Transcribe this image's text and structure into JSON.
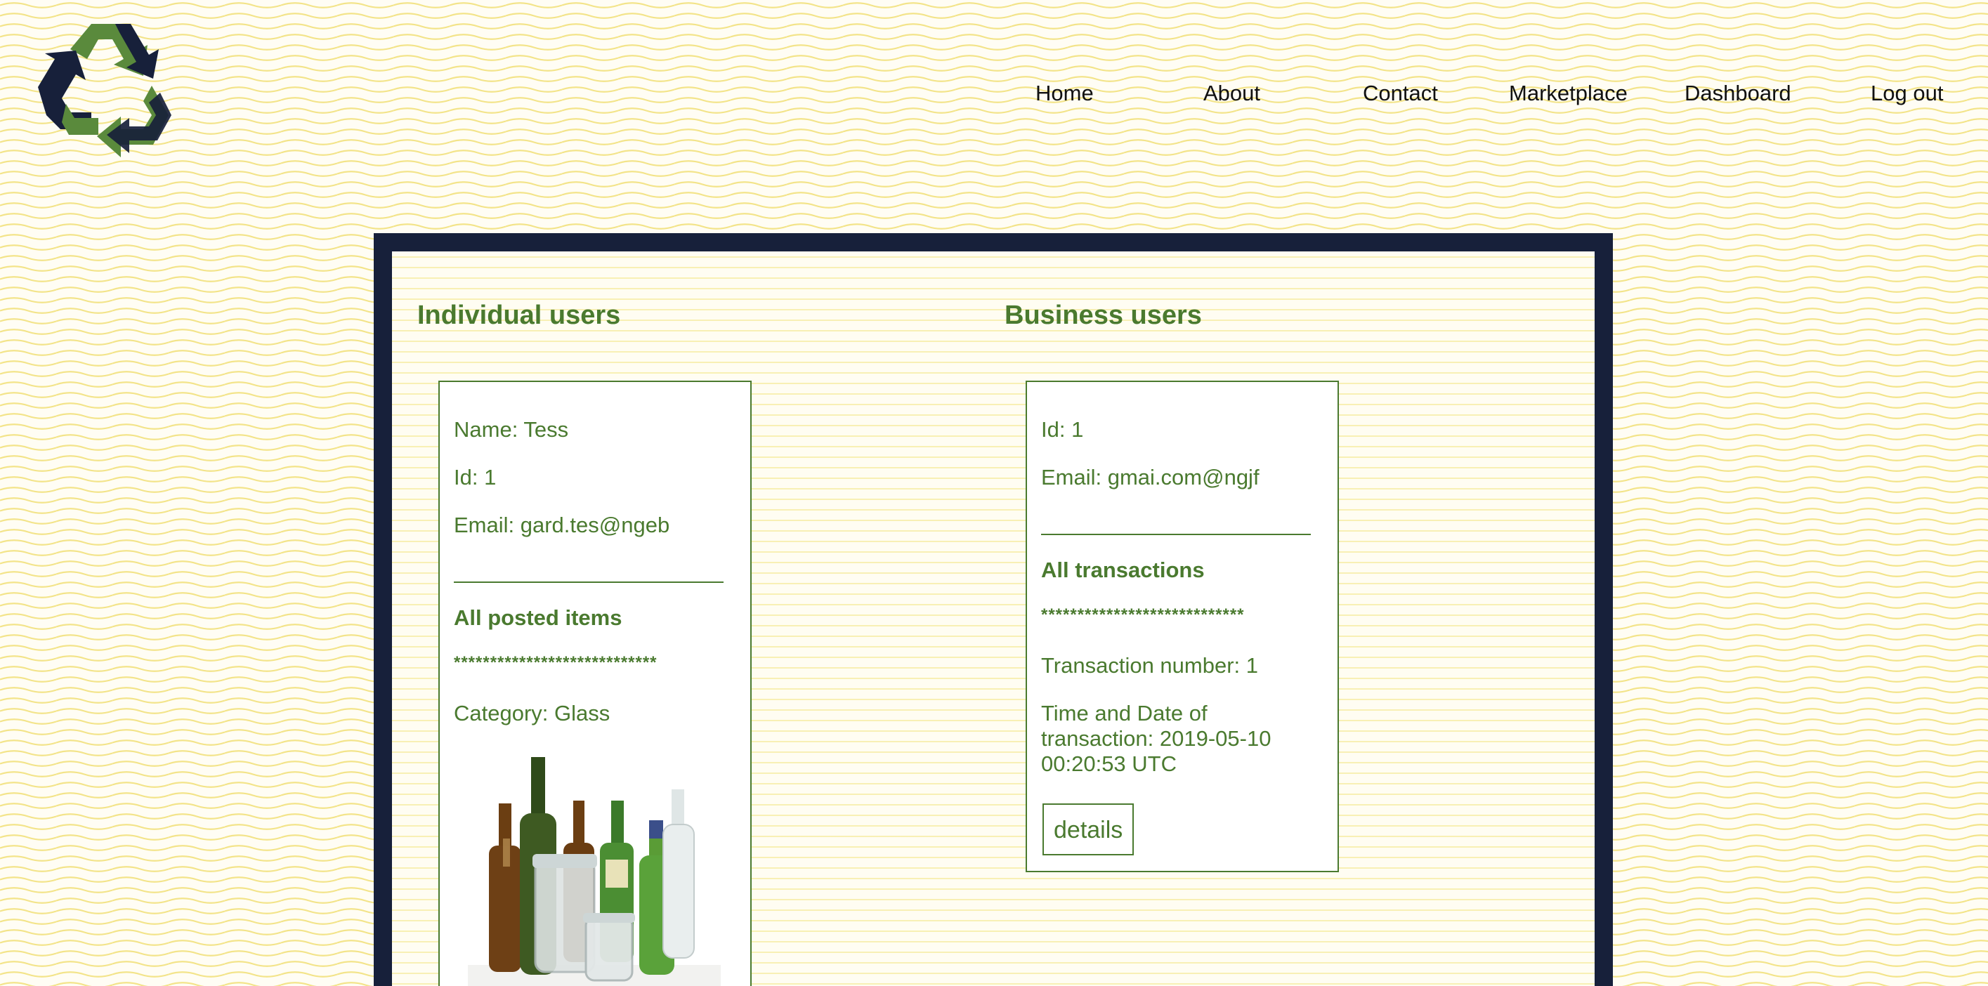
{
  "nav": {
    "items": [
      "Home",
      "About",
      "Contact",
      "Marketplace",
      "Dashboard",
      "Log out"
    ]
  },
  "logo": {
    "icon": "recycle-icon",
    "colors": {
      "green": "#5a8a3c",
      "navy": "#17203a"
    }
  },
  "individual": {
    "title": "Individual users",
    "name_line": "Name: Tess",
    "id_line": "Id: 1",
    "email_line": "Email: gard.tes@ngeb",
    "section_title": "All posted items",
    "stars": "****************************",
    "category_line": "Category: Glass",
    "image": "glass-bottles-image"
  },
  "business": {
    "title": "Business users",
    "id_line": "Id: 1",
    "email_line": "Email: gmai.com@ngjf",
    "section_title": "All transactions",
    "stars": "****************************",
    "transaction_line": "Transaction number: 1",
    "datetime_line": "Time and Date of transaction: 2019-05-10 00:20:53 UTC",
    "details_label": "details"
  },
  "colors": {
    "accent_green": "#4a7a2f",
    "frame_navy": "#17203a",
    "wave_yellow": "#f3e682",
    "background": "#fffdf2"
  }
}
